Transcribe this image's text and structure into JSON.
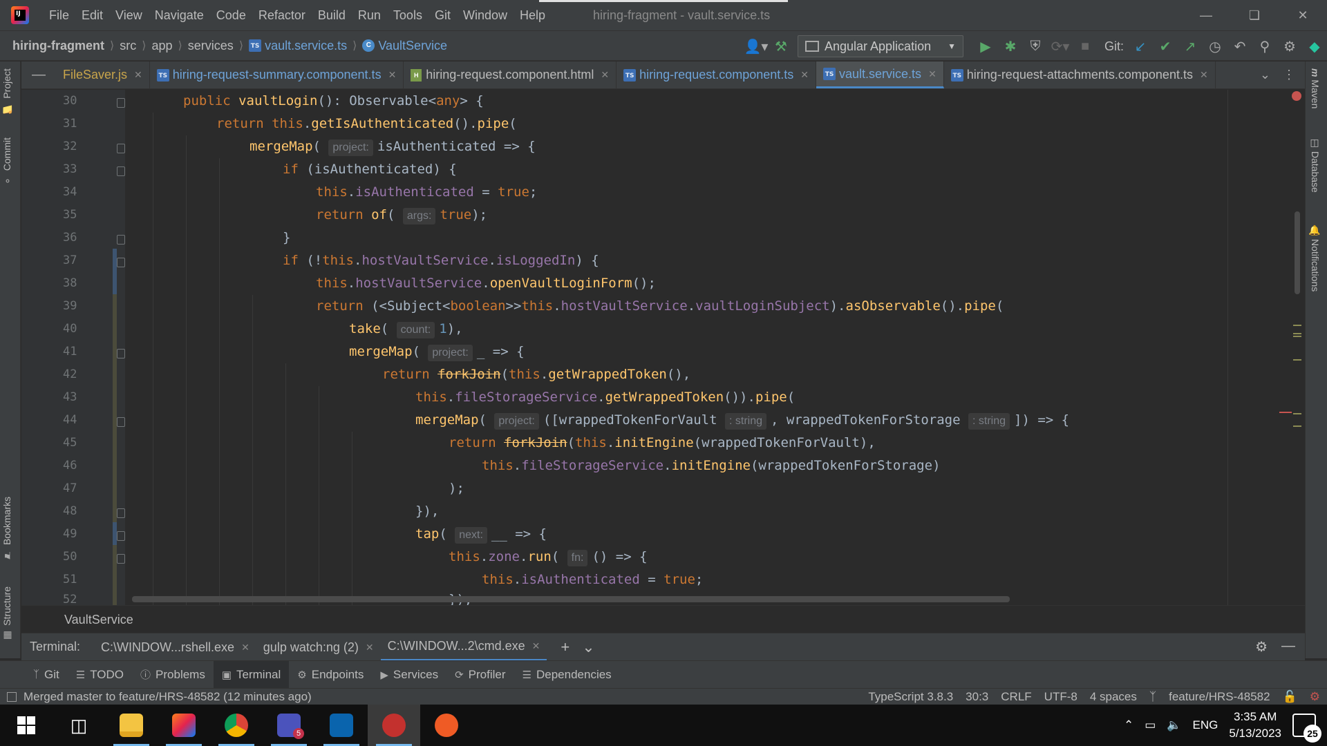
{
  "window": {
    "menu": [
      "File",
      "Edit",
      "View",
      "Navigate",
      "Code",
      "Refactor",
      "Build",
      "Run",
      "Tools",
      "Git",
      "Window",
      "Help"
    ],
    "title": "hiring-fragment - vault.service.ts"
  },
  "navbar": {
    "project": "hiring-fragment",
    "crumbs": [
      "src",
      "app",
      "services"
    ],
    "file": "vault.service.ts",
    "class": "VaultService",
    "run_config": "Angular Application",
    "git_label": "Git:"
  },
  "left_strip": [
    "Project",
    "Commit",
    "Bookmarks",
    "Structure"
  ],
  "right_strip": [
    "Maven",
    "Database",
    "Notifications"
  ],
  "tabs": [
    {
      "label": "FileSaver.js",
      "kind": "js"
    },
    {
      "label": "hiring-request-summary.component.ts",
      "kind": "ts"
    },
    {
      "label": "hiring-request.component.html",
      "kind": "html"
    },
    {
      "label": "hiring-request.component.ts",
      "kind": "ts"
    },
    {
      "label": "vault.service.ts",
      "kind": "ts",
      "active": true
    },
    {
      "label": "hiring-request-attachments.component.ts",
      "kind": "ts"
    }
  ],
  "editor": {
    "line_numbers": [
      "30",
      "31",
      "32",
      "33",
      "34",
      "35",
      "36",
      "37",
      "38",
      "39",
      "40",
      "41",
      "42",
      "43",
      "44",
      "45",
      "46",
      "47",
      "48",
      "49",
      "50",
      "51",
      "52"
    ],
    "hints": {
      "project": "project:",
      "args": "args:",
      "count": "count:",
      "type_string": ": string",
      "next": "next:",
      "fn": "fn:"
    },
    "breadcrumb": "VaultService"
  },
  "terminal": {
    "label": "Terminal:",
    "tabs": [
      "C:\\WINDOW...rshell.exe",
      "gulp watch:ng (2)",
      "C:\\WINDOW...2\\cmd.exe"
    ]
  },
  "tool_windows": [
    "Git",
    "TODO",
    "Problems",
    "Terminal",
    "Endpoints",
    "Services",
    "Profiler",
    "Dependencies"
  ],
  "status": {
    "message": "Merged master to feature/HRS-48582 (12 minutes ago)",
    "language": "TypeScript 3.8.3",
    "position": "30:3",
    "line_ending": "CRLF",
    "encoding": "UTF-8",
    "indent": "4 spaces",
    "branch": "feature/HRS-48582"
  },
  "taskbar": {
    "lang": "ENG",
    "time": "3:35 AM",
    "date": "5/13/2023",
    "notifications": "25",
    "teams_badge": "5"
  }
}
